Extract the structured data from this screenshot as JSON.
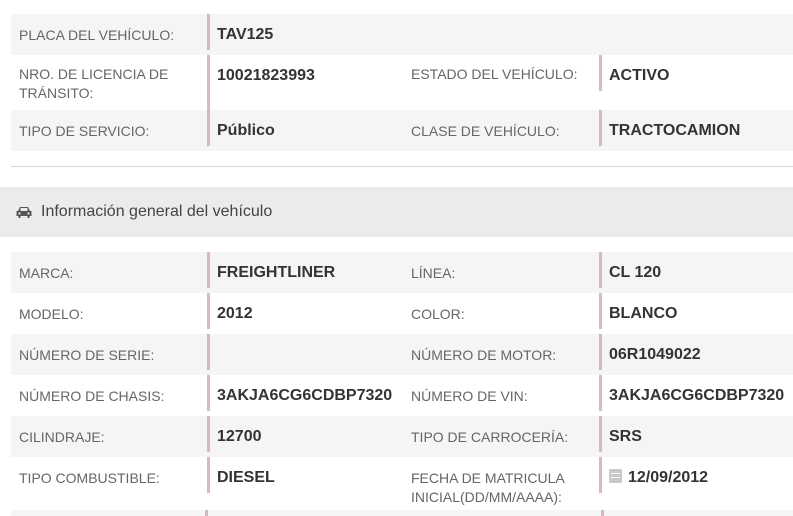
{
  "top_fields": {
    "plate": {
      "label": "PLACA DEL VEHÍCULO:",
      "value": "TAV125"
    },
    "license": {
      "label": "NRO. DE LICENCIA DE TRÁNSITO:",
      "value": "10021823993"
    },
    "state": {
      "label": "ESTADO DEL VEHÍCULO:",
      "value": "ACTIVO"
    },
    "service": {
      "label": "TIPO DE SERVICIO:",
      "value": "Público"
    },
    "vehicle_class": {
      "label": "CLASE DE VEHÍCULO:",
      "value": "TRACTOCAMION"
    }
  },
  "section": {
    "icon": "car-icon",
    "title": "Información general del vehículo"
  },
  "general": {
    "marca": {
      "label": "MARCA:",
      "value": "FREIGHTLINER"
    },
    "linea": {
      "label": "LÍNEA:",
      "value": "CL 120"
    },
    "modelo": {
      "label": "MODELO:",
      "value": "2012"
    },
    "color": {
      "label": "COLOR:",
      "value": "BLANCO"
    },
    "serie": {
      "label": "NÚMERO DE SERIE:",
      "value": ""
    },
    "motor": {
      "label": "NÚMERO DE MOTOR:",
      "value": "06R1049022"
    },
    "chasis": {
      "label": "NÚMERO DE CHASIS:",
      "value": "3AKJA6CG6CDBP7320"
    },
    "vin": {
      "label": "NÚMERO DE VIN:",
      "value": "3AKJA6CG6CDBP7320"
    },
    "cilindraje": {
      "label": "CILINDRAJE:",
      "value": "12700"
    },
    "carroceria": {
      "label": "TIPO DE CARROCERÍA:",
      "value": "SRS"
    },
    "combustible": {
      "label": "TIPO COMBUSTIBLE:",
      "value": "DIESEL"
    },
    "matricula": {
      "label": "FECHA DE MATRICULA INICIAL(DD/MM/AAAA):",
      "value": "12/09/2012",
      "icon": "calendar-icon"
    }
  }
}
